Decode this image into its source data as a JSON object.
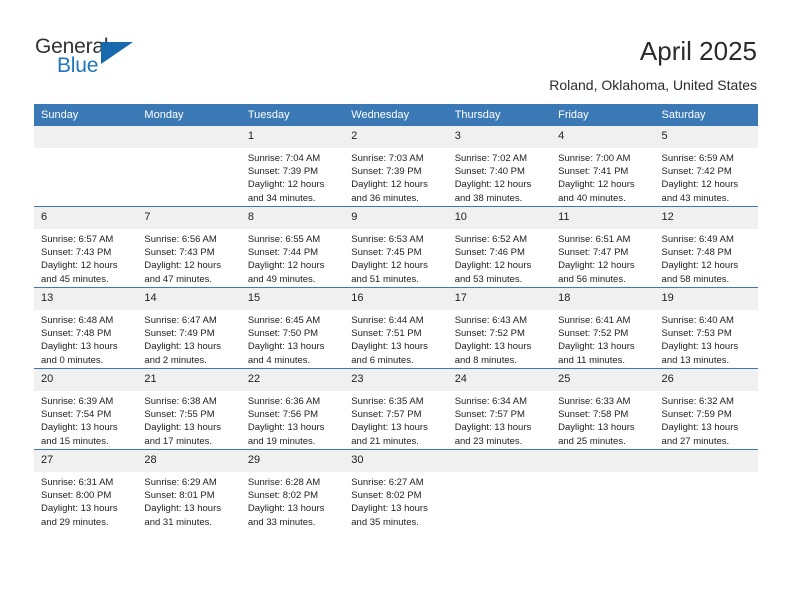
{
  "brand": {
    "name_top": "General",
    "name_bottom": "Blue",
    "accent_color": "#1669ad",
    "triangle_icon": "triangle-icon"
  },
  "header": {
    "title": "April 2025",
    "subtitle": "Roland, Oklahoma, United States",
    "header_bg": "#3b79b6",
    "daynum_bg": "#f0f0f0"
  },
  "weekdays": [
    "Sunday",
    "Monday",
    "Tuesday",
    "Wednesday",
    "Thursday",
    "Friday",
    "Saturday"
  ],
  "labels": {
    "sunrise": "Sunrise:",
    "sunset": "Sunset:",
    "daylight": "Daylight:"
  },
  "weeks": [
    [
      {
        "day": "",
        "sunrise": "",
        "sunset": "",
        "daylight_1": "",
        "daylight_2": ""
      },
      {
        "day": "",
        "sunrise": "",
        "sunset": "",
        "daylight_1": "",
        "daylight_2": ""
      },
      {
        "day": "1",
        "sunrise": "Sunrise: 7:04 AM",
        "sunset": "Sunset: 7:39 PM",
        "daylight_1": "Daylight: 12 hours",
        "daylight_2": "and 34 minutes."
      },
      {
        "day": "2",
        "sunrise": "Sunrise: 7:03 AM",
        "sunset": "Sunset: 7:39 PM",
        "daylight_1": "Daylight: 12 hours",
        "daylight_2": "and 36 minutes."
      },
      {
        "day": "3",
        "sunrise": "Sunrise: 7:02 AM",
        "sunset": "Sunset: 7:40 PM",
        "daylight_1": "Daylight: 12 hours",
        "daylight_2": "and 38 minutes."
      },
      {
        "day": "4",
        "sunrise": "Sunrise: 7:00 AM",
        "sunset": "Sunset: 7:41 PM",
        "daylight_1": "Daylight: 12 hours",
        "daylight_2": "and 40 minutes."
      },
      {
        "day": "5",
        "sunrise": "Sunrise: 6:59 AM",
        "sunset": "Sunset: 7:42 PM",
        "daylight_1": "Daylight: 12 hours",
        "daylight_2": "and 43 minutes."
      }
    ],
    [
      {
        "day": "6",
        "sunrise": "Sunrise: 6:57 AM",
        "sunset": "Sunset: 7:43 PM",
        "daylight_1": "Daylight: 12 hours",
        "daylight_2": "and 45 minutes."
      },
      {
        "day": "7",
        "sunrise": "Sunrise: 6:56 AM",
        "sunset": "Sunset: 7:43 PM",
        "daylight_1": "Daylight: 12 hours",
        "daylight_2": "and 47 minutes."
      },
      {
        "day": "8",
        "sunrise": "Sunrise: 6:55 AM",
        "sunset": "Sunset: 7:44 PM",
        "daylight_1": "Daylight: 12 hours",
        "daylight_2": "and 49 minutes."
      },
      {
        "day": "9",
        "sunrise": "Sunrise: 6:53 AM",
        "sunset": "Sunset: 7:45 PM",
        "daylight_1": "Daylight: 12 hours",
        "daylight_2": "and 51 minutes."
      },
      {
        "day": "10",
        "sunrise": "Sunrise: 6:52 AM",
        "sunset": "Sunset: 7:46 PM",
        "daylight_1": "Daylight: 12 hours",
        "daylight_2": "and 53 minutes."
      },
      {
        "day": "11",
        "sunrise": "Sunrise: 6:51 AM",
        "sunset": "Sunset: 7:47 PM",
        "daylight_1": "Daylight: 12 hours",
        "daylight_2": "and 56 minutes."
      },
      {
        "day": "12",
        "sunrise": "Sunrise: 6:49 AM",
        "sunset": "Sunset: 7:48 PM",
        "daylight_1": "Daylight: 12 hours",
        "daylight_2": "and 58 minutes."
      }
    ],
    [
      {
        "day": "13",
        "sunrise": "Sunrise: 6:48 AM",
        "sunset": "Sunset: 7:48 PM",
        "daylight_1": "Daylight: 13 hours",
        "daylight_2": "and 0 minutes."
      },
      {
        "day": "14",
        "sunrise": "Sunrise: 6:47 AM",
        "sunset": "Sunset: 7:49 PM",
        "daylight_1": "Daylight: 13 hours",
        "daylight_2": "and 2 minutes."
      },
      {
        "day": "15",
        "sunrise": "Sunrise: 6:45 AM",
        "sunset": "Sunset: 7:50 PM",
        "daylight_1": "Daylight: 13 hours",
        "daylight_2": "and 4 minutes."
      },
      {
        "day": "16",
        "sunrise": "Sunrise: 6:44 AM",
        "sunset": "Sunset: 7:51 PM",
        "daylight_1": "Daylight: 13 hours",
        "daylight_2": "and 6 minutes."
      },
      {
        "day": "17",
        "sunrise": "Sunrise: 6:43 AM",
        "sunset": "Sunset: 7:52 PM",
        "daylight_1": "Daylight: 13 hours",
        "daylight_2": "and 8 minutes."
      },
      {
        "day": "18",
        "sunrise": "Sunrise: 6:41 AM",
        "sunset": "Sunset: 7:52 PM",
        "daylight_1": "Daylight: 13 hours",
        "daylight_2": "and 11 minutes."
      },
      {
        "day": "19",
        "sunrise": "Sunrise: 6:40 AM",
        "sunset": "Sunset: 7:53 PM",
        "daylight_1": "Daylight: 13 hours",
        "daylight_2": "and 13 minutes."
      }
    ],
    [
      {
        "day": "20",
        "sunrise": "Sunrise: 6:39 AM",
        "sunset": "Sunset: 7:54 PM",
        "daylight_1": "Daylight: 13 hours",
        "daylight_2": "and 15 minutes."
      },
      {
        "day": "21",
        "sunrise": "Sunrise: 6:38 AM",
        "sunset": "Sunset: 7:55 PM",
        "daylight_1": "Daylight: 13 hours",
        "daylight_2": "and 17 minutes."
      },
      {
        "day": "22",
        "sunrise": "Sunrise: 6:36 AM",
        "sunset": "Sunset: 7:56 PM",
        "daylight_1": "Daylight: 13 hours",
        "daylight_2": "and 19 minutes."
      },
      {
        "day": "23",
        "sunrise": "Sunrise: 6:35 AM",
        "sunset": "Sunset: 7:57 PM",
        "daylight_1": "Daylight: 13 hours",
        "daylight_2": "and 21 minutes."
      },
      {
        "day": "24",
        "sunrise": "Sunrise: 6:34 AM",
        "sunset": "Sunset: 7:57 PM",
        "daylight_1": "Daylight: 13 hours",
        "daylight_2": "and 23 minutes."
      },
      {
        "day": "25",
        "sunrise": "Sunrise: 6:33 AM",
        "sunset": "Sunset: 7:58 PM",
        "daylight_1": "Daylight: 13 hours",
        "daylight_2": "and 25 minutes."
      },
      {
        "day": "26",
        "sunrise": "Sunrise: 6:32 AM",
        "sunset": "Sunset: 7:59 PM",
        "daylight_1": "Daylight: 13 hours",
        "daylight_2": "and 27 minutes."
      }
    ],
    [
      {
        "day": "27",
        "sunrise": "Sunrise: 6:31 AM",
        "sunset": "Sunset: 8:00 PM",
        "daylight_1": "Daylight: 13 hours",
        "daylight_2": "and 29 minutes."
      },
      {
        "day": "28",
        "sunrise": "Sunrise: 6:29 AM",
        "sunset": "Sunset: 8:01 PM",
        "daylight_1": "Daylight: 13 hours",
        "daylight_2": "and 31 minutes."
      },
      {
        "day": "29",
        "sunrise": "Sunrise: 6:28 AM",
        "sunset": "Sunset: 8:02 PM",
        "daylight_1": "Daylight: 13 hours",
        "daylight_2": "and 33 minutes."
      },
      {
        "day": "30",
        "sunrise": "Sunrise: 6:27 AM",
        "sunset": "Sunset: 8:02 PM",
        "daylight_1": "Daylight: 13 hours",
        "daylight_2": "and 35 minutes."
      },
      {
        "day": "",
        "sunrise": "",
        "sunset": "",
        "daylight_1": "",
        "daylight_2": ""
      },
      {
        "day": "",
        "sunrise": "",
        "sunset": "",
        "daylight_1": "",
        "daylight_2": ""
      },
      {
        "day": "",
        "sunrise": "",
        "sunset": "",
        "daylight_1": "",
        "daylight_2": ""
      }
    ]
  ]
}
